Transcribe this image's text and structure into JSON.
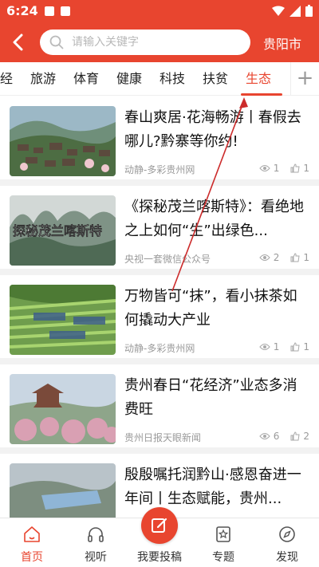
{
  "status_bar": {
    "time": "6:24"
  },
  "header": {
    "search_placeholder": "请输入关键字",
    "city": "贵阳市"
  },
  "categories": [
    "经",
    "旅游",
    "体育",
    "健康",
    "科技",
    "扶贫",
    "生态"
  ],
  "active_category": "生态",
  "add_category_glyph": "+",
  "articles": [
    {
      "title": "春山爽居·花海畅游丨春假去哪儿?黔寨等你约!",
      "source": "动静-多彩贵州网",
      "views": "1",
      "likes": "1"
    },
    {
      "title": "《探秘茂兰喀斯特》：看绝地之上如何“生”出绿色...",
      "source": "央视一套微信公众号",
      "views": "2",
      "likes": "1"
    },
    {
      "title": "万物皆可“抹”，看小抹茶如何撬动大产业",
      "source": "动静-多彩贵州网",
      "views": "1",
      "likes": "1"
    },
    {
      "title": "贵州春日“花经济”业态多消费旺",
      "source": "贵州日报天眼新闻",
      "views": "6",
      "likes": "2"
    },
    {
      "title": "殷殷嘱托润黔山·感恩奋进一年间丨生态赋能，贵州...",
      "source": "",
      "views": "",
      "likes": ""
    }
  ],
  "thumb_overlay_text": "探秘茂兰喀斯特",
  "bottom_nav": {
    "home": "首页",
    "listen": "视听",
    "post": "我要投稿",
    "topic": "专题",
    "discover": "发现"
  },
  "colors": {
    "brand": "#e8452f",
    "text": "#111111",
    "meta": "#9a9a9a"
  }
}
